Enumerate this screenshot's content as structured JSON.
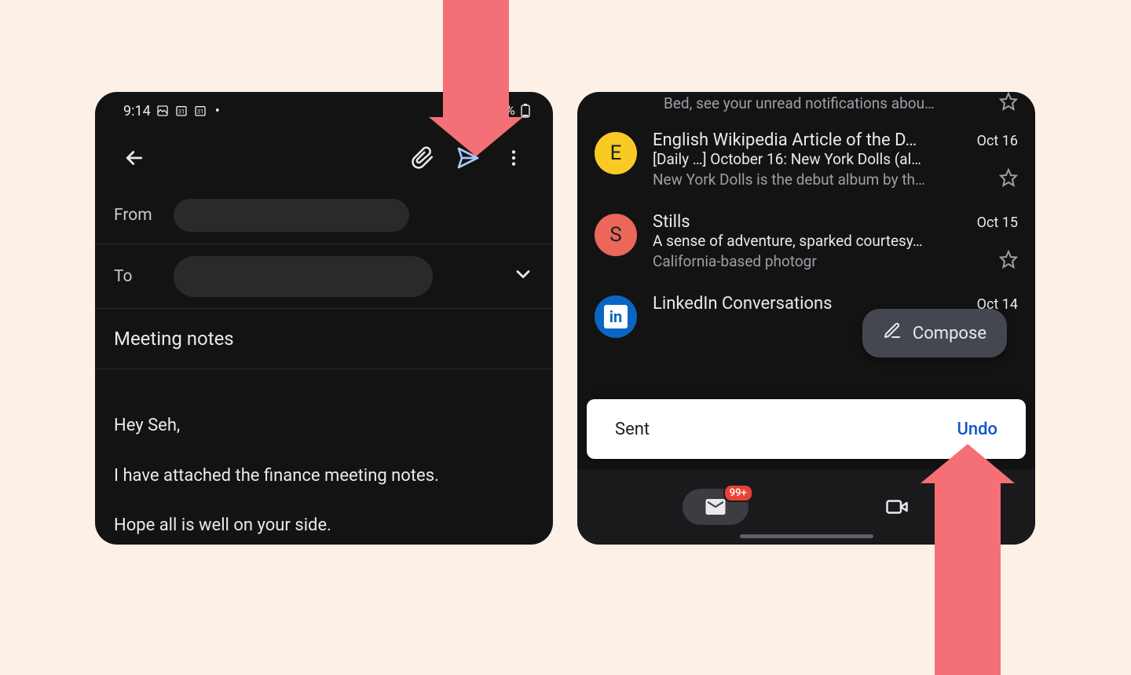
{
  "left": {
    "status": {
      "time": "9:14",
      "battery": "5%"
    },
    "fields": {
      "from": "From",
      "to": "To"
    },
    "subject": "Meeting notes",
    "body": "Hey Seh,\n\nI have attached the finance meeting notes.\n\nHope all is well on your side."
  },
  "right": {
    "partial_top": {
      "preview": "Bed, see your unread notifications abou…"
    },
    "items": [
      {
        "avatar_letter": "E",
        "sender": "English Wikipedia Article of the D…",
        "date": "Oct 16",
        "subject": "[Daily …] October 16: New York Dolls (al…",
        "preview": "New York Dolls is the debut album by th…"
      },
      {
        "avatar_letter": "S",
        "sender": "Stills",
        "date": "Oct 15",
        "subject": "A sense of adventure, sparked courtesy…",
        "preview": "California-based photogr"
      },
      {
        "sender": "LinkedIn Conversations",
        "date": "Oct 14"
      }
    ],
    "compose": "Compose",
    "snackbar": {
      "text": "Sent",
      "action": "Undo"
    },
    "nav": {
      "badge": "99+"
    }
  }
}
